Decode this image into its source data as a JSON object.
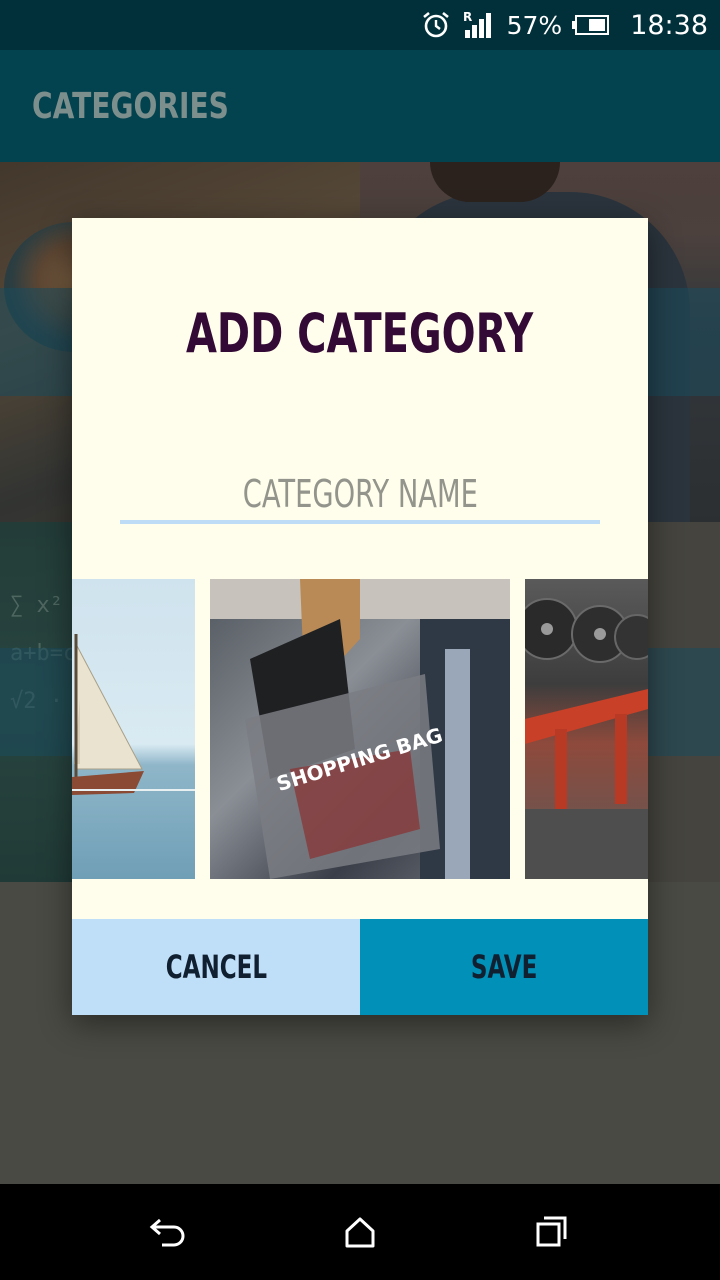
{
  "status_bar": {
    "battery_percent": "57%",
    "time": "18:38",
    "icons": [
      "alarm-icon",
      "signal-roaming-icon",
      "battery-icon"
    ],
    "roaming_indicator": "R"
  },
  "app_bar": {
    "title": "CATEGORIES",
    "background": "#03424f"
  },
  "dialog": {
    "title": "ADD CATEGORY",
    "input_placeholder": "CATEGORY NAME",
    "images": [
      {
        "name": "sailboat-image",
        "label": "sailboat"
      },
      {
        "name": "shopping-image",
        "label": "SHOPPING BAG"
      },
      {
        "name": "gym-image",
        "label": "gym weights"
      }
    ],
    "cancel_label": "CANCEL",
    "save_label": "SAVE",
    "colors": {
      "title": "#330a36",
      "background": "#fffdeb",
      "cancel": "#bfdef8",
      "save": "#0190b8"
    }
  },
  "nav_bar": {
    "icons": [
      "back-icon",
      "home-icon",
      "recents-icon"
    ]
  }
}
